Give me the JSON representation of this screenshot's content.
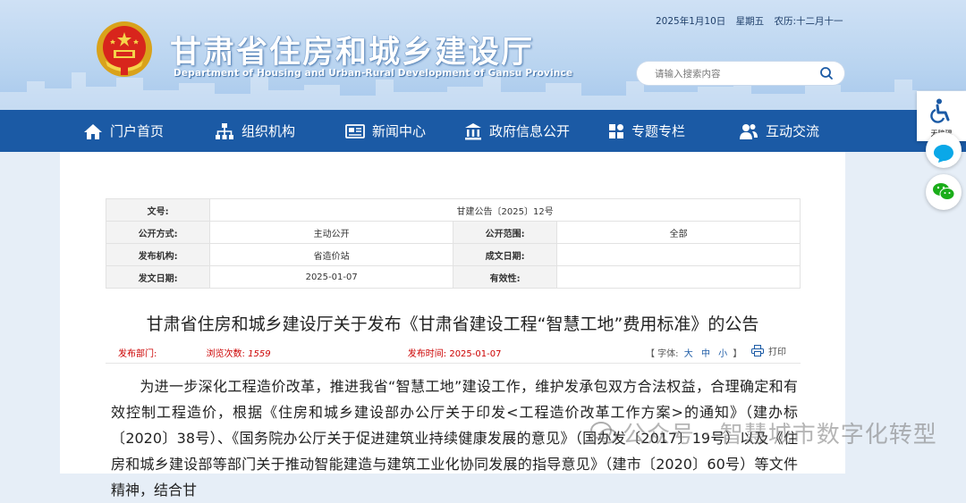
{
  "header": {
    "title": "甘肃省住房和城乡建设厅",
    "subtitle": "Department of Housing and Urban-Rural Development of Gansu Province",
    "date": "2025年1月10日",
    "weekday": "星期五",
    "lunar": "农历:十二月十一",
    "search_placeholder": "请输入搜索内容"
  },
  "nav": {
    "items": [
      {
        "label": "门户首页",
        "icon": "home-icon"
      },
      {
        "label": "组织机构",
        "icon": "org-chart-icon"
      },
      {
        "label": "新闻中心",
        "icon": "newspaper-icon"
      },
      {
        "label": "政府信息公开",
        "icon": "government-building-icon"
      },
      {
        "label": "专题专栏",
        "icon": "grid-icon"
      },
      {
        "label": "互动交流",
        "icon": "users-icon"
      }
    ]
  },
  "side": {
    "accessibility_label": "无障碍",
    "icons": [
      "wheelchair-icon",
      "chat-bubble-icon",
      "wechat-icon"
    ]
  },
  "meta": {
    "doc_no_label": "文号:",
    "doc_no": "甘建公告〔2025〕12号",
    "method_label": "公开方式:",
    "method": "主动公开",
    "scope_label": "公开范围:",
    "scope": "全部",
    "publisher_label": "发布机构:",
    "publisher": "省造价站",
    "written_label": "成文日期:",
    "written": "",
    "issued_label": "发文日期:",
    "issued": "2025-01-07",
    "validity_label": "有效性:",
    "validity": ""
  },
  "article": {
    "title": "甘肃省住房和城乡建设厅关于发布《甘肃省建设工程“智慧工地”费用标准》的公告",
    "dept_label": "发布部门:",
    "views_label": "浏览次数:",
    "views": "1559",
    "time_label": "发布时间:",
    "time": "2025-01-07",
    "font_label": "【 字体:",
    "font_large": "大",
    "font_medium": "中",
    "font_small": "小",
    "font_close": "】",
    "print_label": "打印",
    "body": "为进一步深化工程造价改革，推进我省“智慧工地”建设工作，维护发承包双方合法权益，合理确定和有效控制工程造价，根据《住房和城乡建设部办公厅关于印发<工程造价改革工作方案>的通知》（建办标〔2020〕38号）、《国务院办公厅关于促进建筑业持续健康发展的意见》（国办发〔2017〕19号）以及《住房和城乡建设部等部门关于推动智能建造与建筑工业化协同发展的指导意见》（建市〔2020〕60号）等文件精神，结合甘"
  },
  "watermark": "公众号 · 智慧城市数字化转型",
  "colors": {
    "nav_bg": "#1b5aa5",
    "accent_red": "#cc0000"
  }
}
